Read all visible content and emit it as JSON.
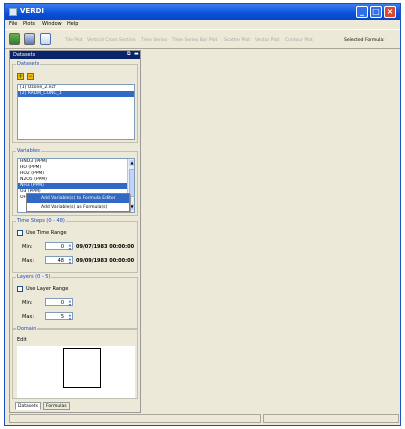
{
  "window": {
    "title": "VERDI"
  },
  "menubar": {
    "items": [
      "File",
      "Plots",
      "Window",
      "Help"
    ]
  },
  "toolbar": {
    "plot_buttons": [
      "Tile Plot",
      "Vertical Cross Section",
      "Time Series",
      "Time Series Bar Plot",
      "Scatter Plot",
      "Vector Plot",
      "Contour Plot"
    ],
    "selected_formula_label": "Selected Formula:",
    "icons": [
      "open-dataset-icon",
      "save-icon",
      "image-icon"
    ]
  },
  "left_panel": {
    "title": "Datasets",
    "datasets": {
      "title": "Datasets",
      "items": [
        "[1] Ozone_2.ncf",
        "[2] RADM_CONC_1"
      ],
      "selected_index": 1
    },
    "variables": {
      "title": "Variables",
      "items": [
        "HNO3 (PPM)",
        "HO (PPM)",
        "HO2 (PPM)",
        "N2O5 (PPM)",
        "NH3 (PPM)",
        "O3 (PPM)",
        "OH (PPM)"
      ],
      "selected_index": 4,
      "context_menu": [
        "Add Variable(s) to Formula Editor",
        "Add Variable(s) as Formula(s)"
      ]
    },
    "time_steps": {
      "title": "Time Steps (0 - 48)",
      "use_range_label": "Use Time Range",
      "min_label": "Min:",
      "min_value": "0",
      "min_date": "09/07/1983 00:00:00",
      "max_label": "Max:",
      "max_value": "48",
      "max_date": "09/09/1983 00:00:00"
    },
    "layers": {
      "title": "Layers (0 - 5)",
      "use_range_label": "Use Layer Range",
      "min_label": "Min:",
      "min_value": "0",
      "max_label": "Max:",
      "max_value": "5"
    },
    "domain": {
      "title": "Domain",
      "edit_label": "Edit"
    },
    "tabs": [
      "Datasets",
      "Formulas"
    ]
  },
  "colors": {
    "titlebar": "#0a4fd8",
    "selection": "#316ac5",
    "group_title": "#1f4bbd"
  }
}
